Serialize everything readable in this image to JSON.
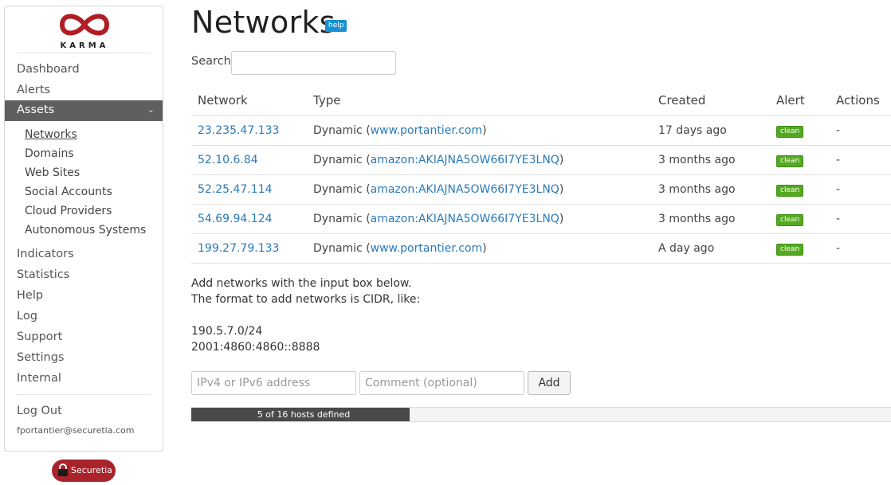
{
  "sidebar": {
    "logo_text": "KARMA",
    "nav_top": [
      "Dashboard",
      "Alerts"
    ],
    "active_item": "Assets",
    "sub_items": [
      "Networks",
      "Domains",
      "Web Sites",
      "Social Accounts",
      "Cloud Providers",
      "Autonomous Systems"
    ],
    "nav_bottom": [
      "Indicators",
      "Statistics",
      "Help",
      "Log",
      "Support",
      "Settings",
      "Internal"
    ],
    "logout": "Log Out",
    "user_email": "fportantier@securetia.com"
  },
  "brand": {
    "name": "Securetia",
    "color": "#a8232a"
  },
  "page": {
    "title": "Networks",
    "help_label": "help",
    "search_label": "Search:",
    "search_value": ""
  },
  "table": {
    "headers": [
      "Network",
      "Type",
      "Created",
      "Alert",
      "Actions"
    ],
    "rows": [
      {
        "network": "23.235.47.133",
        "type_prefix": "Dynamic (",
        "type_link": "www.portantier.com",
        "type_suffix": ")",
        "created": "17 days ago",
        "alert": "clean",
        "actions": "-"
      },
      {
        "network": "52.10.6.84",
        "type_prefix": "Dynamic (",
        "type_link": "amazon:AKIAJNA5OW66I7YE3LNQ",
        "type_suffix": ")",
        "created": "3 months ago",
        "alert": "clean",
        "actions": "-"
      },
      {
        "network": "52.25.47.114",
        "type_prefix": "Dynamic (",
        "type_link": "amazon:AKIAJNA5OW66I7YE3LNQ",
        "type_suffix": ")",
        "created": "3 months ago",
        "alert": "clean",
        "actions": "-"
      },
      {
        "network": "54.69.94.124",
        "type_prefix": "Dynamic (",
        "type_link": "amazon:AKIAJNA5OW66I7YE3LNQ",
        "type_suffix": ")",
        "created": "3 months ago",
        "alert": "clean",
        "actions": "-"
      },
      {
        "network": "199.27.79.133",
        "type_prefix": "Dynamic (",
        "type_link": "www.portantier.com",
        "type_suffix": ")",
        "created": "A day ago",
        "alert": "clean",
        "actions": "-"
      }
    ]
  },
  "info": {
    "line1": "Add networks with the input box below.",
    "line2": "The format to add networks is CIDR, like:",
    "example1": "190.5.7.0/24",
    "example2": "2001:4860:4860::8888"
  },
  "form": {
    "address_placeholder": "IPv4 or IPv6 address",
    "comment_placeholder": "Comment (optional)",
    "add_label": "Add"
  },
  "progress": {
    "text": "5 of 16 hosts defined",
    "defined": 5,
    "total": 16
  },
  "colors": {
    "link": "#2a7ab8",
    "clean_badge": "#55a821",
    "help_badge": "#1a90d0",
    "active_nav": "#5f5f5f"
  }
}
